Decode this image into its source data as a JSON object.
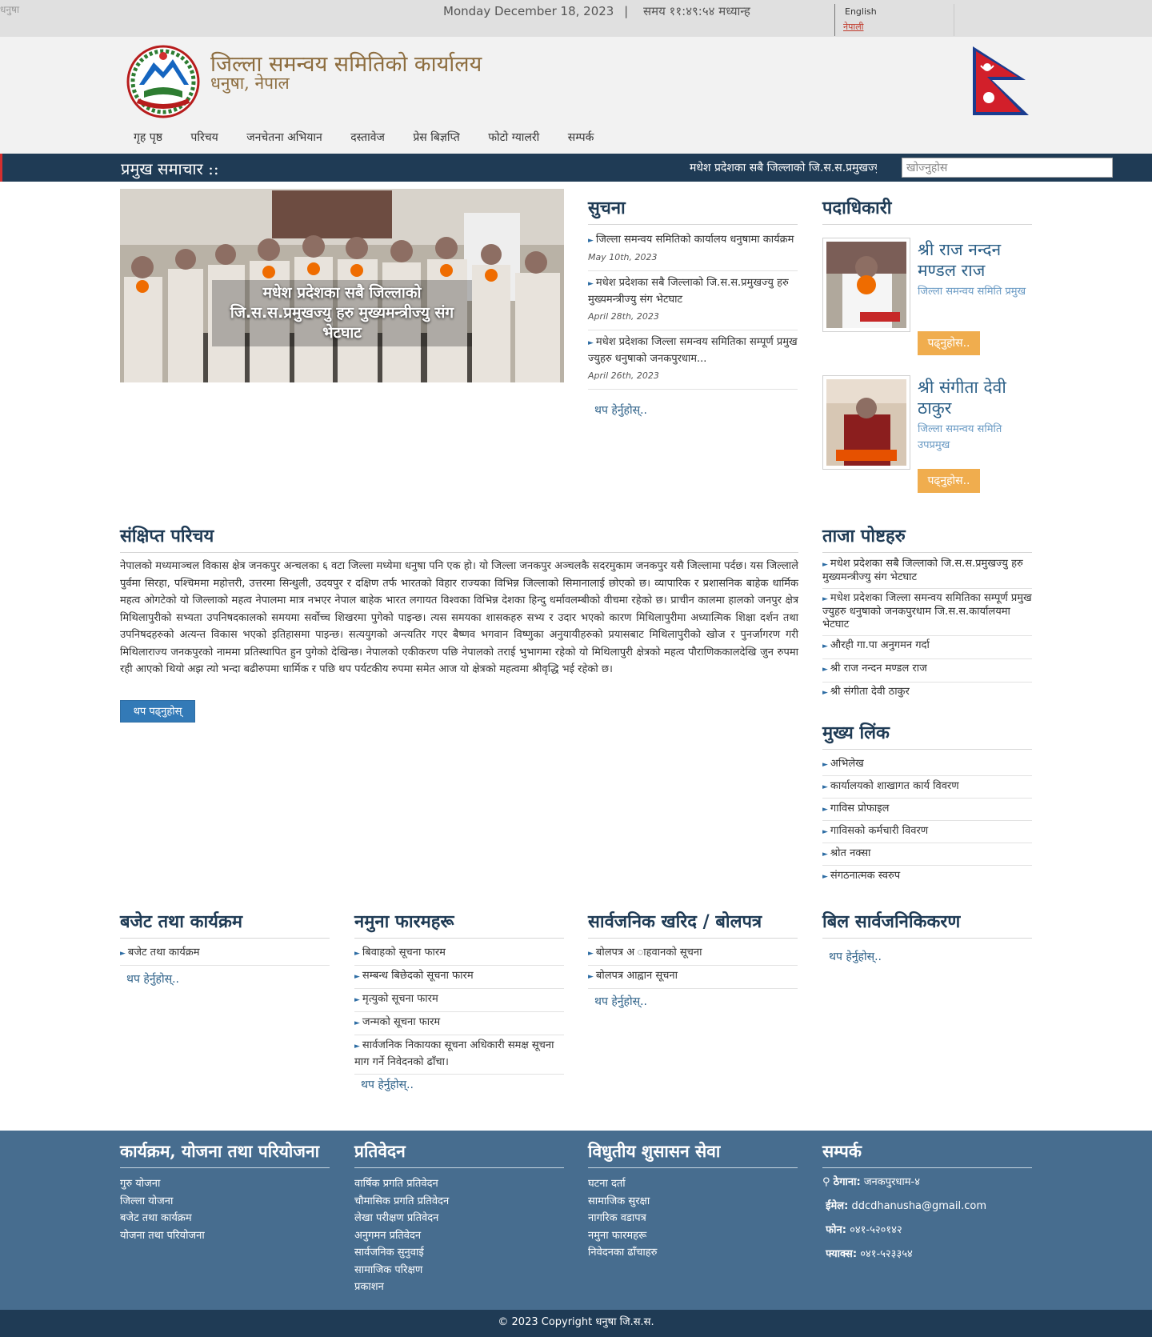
{
  "topbar": {
    "broken_image_alt": "धनुषा",
    "date": "Monday December 18, 2023",
    "separator": "|",
    "time": "समय ११:४९:५४ मध्यान्ह",
    "lang_english": "English",
    "lang_nepali": "नेपाली"
  },
  "header": {
    "title": "जिल्ला समन्वय समितिको कार्यालय",
    "subtitle": "धनुषा, नेपाल",
    "emblem_icon": "nepal-emblem-icon",
    "flag_icon": "nepal-flag-icon"
  },
  "nav": {
    "items": [
      "गृह पृष्ठ",
      "परिचय",
      "जनचेतना अभियान",
      "दस्तावेज",
      "प्रेस बिज्ञप्ति",
      "फोटो ग्यालरी",
      "सम्पर्क"
    ]
  },
  "ticker": {
    "label": "प्रमुख समाचार ::",
    "text": "मधेश प्रदेशका सबै जिल्लाको जि.स.स.प्रमुखज्यु",
    "search_placeholder": "खोज्नुहोस"
  },
  "slider": {
    "caption": "मधेश प्रदेशका सबै जिल्लाको जि.स.स.प्रमुखज्यु हरु मुख्यमन्त्रीज्यु संग भेटघाट"
  },
  "notice": {
    "heading": "सुचना",
    "items": [
      {
        "title": "जिल्ला समन्वय समितिको कार्यालय धनुषामा कार्यक्रम",
        "date": "May 10th, 2023"
      },
      {
        "title": "मधेश प्रदेशका सबै जिल्लाको जि.स.स.प्रमुखज्यु हरु मुख्यमन्त्रीज्यु संग भेटघाट",
        "date": "April 28th, 2023"
      },
      {
        "title": "मधेश प्रदेशका जिल्ला समन्वय समितिका सम्पूर्ण प्रमुख ज्युहरु धनुषाको जनकपुरधाम...",
        "date": "April 26th, 2023"
      }
    ],
    "more": "थप हेर्नुहोस्.."
  },
  "officials": {
    "heading": "पदाधिकारी",
    "people": [
      {
        "name": "श्री राज नन्दन मण्डल राज",
        "post": "जिल्ला समन्वय समिति प्रमुख",
        "button": "पढ्नुहोस.."
      },
      {
        "name": "श्री संगीता देवी ठाकुर",
        "post": "जिल्ला समन्वय समिति उपप्रमुख",
        "button": "पढ्नुहोस.."
      }
    ]
  },
  "intro": {
    "heading": "संक्षिप्त परिचय",
    "text": "नेपालको मध्यमाञ्चल विकास क्षेत्र जनकपुर अन्चलका ६ वटा जिल्ला मध्येमा धनुषा पनि एक हो। यो जिल्ला जनकपुर अञ्चलकै सदरमुकाम जनकपुर यसै जिल्लामा पर्दछ। यस जिल्लाले पुर्वमा सिरहा, पश्चिममा महोत्तरी, उत्तरमा सिन्धुली, उदयपुर र दक्षिण तर्फ भारतको विहार राज्यका विभिन्न जिल्लाको सिमानालाई छोएको छ। व्यापारिक र प्रशासनिक बाहेक धार्मिक महत्व ओगटेको यो जिल्लाको महत्व नेपालमा मात्र नभएर नेपाल बाहेक भारत लगायत विश्वका विभिन्न देशका हिन्दु धर्मावलम्बीको वीचमा रहेको छ। प्राचीन कालमा हालको जनपुर क्षेत्र मिथिलापुरीको सभ्यता उपनिषदकालको समयमा सर्वोच्च शिखरमा पुगेको पाइन्छ। त्यस समयका शासकहरु सभ्य र उदार भएको कारण मिथिलापुरीमा अध्यात्मिक शिक्षा दर्शन तथा उपनिषदहरुको अत्यन्त विकास भएको इतिहासमा पाइन्छ। सत्ययुगको अन्त्यतिर गएर बैष्णव भगवान विष्णुका अनुयायीहरुको प्रयासबाट मिथिलापुरीको खोज र पुनर्जागरण गरी मिथिलाराज्य जनकपुरको नाममा प्रतिस्थापित हुन पुगेको देखिन्छ। नेपालको एकीकरण पछि नेपालको तराई भुभागमा रहेको यो मिथिलापुरी क्षेत्रको महत्व पौराणिककालदेखि जुन रुपमा रही आएको थियो अझ त्यो भन्दा बढीरुपमा धार्मिक र पछि थप पर्यटकीय रुपमा समेत आज यो क्षेत्रको महत्वमा श्रीवृद्धि भई रहेको छ।",
    "button": "थप पढ्नुहोस्"
  },
  "latest": {
    "heading": "ताजा पोष्टहरु",
    "items": [
      "मधेश प्रदेशका सबै जिल्लाको जि.स.स.प्रमुखज्यु हरु मुख्यमन्त्रीज्यु संग भेटघाट",
      "मधेश प्रदेशका जिल्ला समन्वय समितिका सम्पूर्ण प्रमुख ज्युहरु धनुषाको जनकपुरधाम जि.स.स.कार्यालयमा भेटघाट",
      "औरही गा.पा अनुगमन गर्दा",
      "श्री राज नन्दन मण्डल राज",
      "श्री संगीता देवी ठाकुर"
    ]
  },
  "links": {
    "heading": "मुख्य लिंक",
    "items": [
      "अभिलेख",
      "कार्यालयको शाखागत कार्य विवरण",
      "गाविस प्रोफाइल",
      "गाविसको कर्मचारी विवरण",
      "श्रोत नक्सा",
      "संगठनात्मक स्वरुप"
    ]
  },
  "budget": {
    "heading": "बजेट तथा कार्यक्रम",
    "items": [
      "बजेट तथा कार्यक्रम"
    ],
    "more": "थप हेर्नुहोस्.."
  },
  "forms": {
    "heading": "नमुना फारमहरू",
    "items": [
      "बिवाहको सूचना फारम",
      "सम्बन्ध बिछेदको सूचना फारम",
      "मृत्युको सूचना फारम",
      "जन्मको सूचना फारम",
      "सार्वजनिक निकायका सूचना अधिकारी समक्ष सूचना माग गर्ने निवेदनको ढाँचा।"
    ],
    "more": "थप हेर्नुहोस्.."
  },
  "procurement": {
    "heading": "सार्वजनिक खरिद / बोलपत्र",
    "items": [
      "बोलपत्र अ ाहवानको सूचना",
      "बोलपत्र आह्वान सूचना"
    ],
    "more": "थप हेर्नुहोस्.."
  },
  "bills": {
    "heading": "बिल सार्वजनिकिकरण",
    "more": "थप हेर्नुहोस्.."
  },
  "footer": {
    "programs": {
      "heading": "कार्यक्रम, योजना तथा परियोजना",
      "items": [
        "गुरु योजना",
        "जिल्ला योजना",
        "बजेट तथा कार्यक्रम",
        "योजना तथा परियोजना"
      ]
    },
    "reports": {
      "heading": "प्रतिवेदन",
      "items": [
        "वार्षिक प्रगति प्रतिवेदन",
        "चौमासिक प्रगति प्रतिवेदन",
        "लेखा परीक्षण प्रतिवेदन",
        "अनुगमन प्रतिवेदन",
        "सार्वजनिक सुनुवाई",
        "सामाजिक परिक्षण",
        "प्रकाशन"
      ]
    },
    "egov": {
      "heading": "विधुतीय शुसासन सेवा",
      "items": [
        "घटना दर्ता",
        "सामाजिक सुरक्षा",
        "नागरिक वडापत्र",
        "नमुना फारमहरू",
        "निवेदनका ढाँचाहरु"
      ]
    },
    "contact": {
      "heading": "सम्पर्क",
      "address_label": "ठेगाना:",
      "address": "जनकपुरधाम-४",
      "email_label": "ईमेल:",
      "email": "ddcdhanusha@gmail.com",
      "phone_label": "फोन:",
      "phone": "०४१-५२०१४२",
      "fax_label": "फ्याक्स:",
      "fax": "०४१-५२३३५४",
      "address_icon": "map-marker-icon"
    },
    "copyright": "© 2023 Copyright धनुषा जि.स.स."
  },
  "colors": {
    "brand_dark": "#1f3b55",
    "footer_bg": "#476d8f",
    "heading_gold": "#8d6d3f",
    "button_orange": "#f0ad4e",
    "button_blue": "#337ab7"
  }
}
